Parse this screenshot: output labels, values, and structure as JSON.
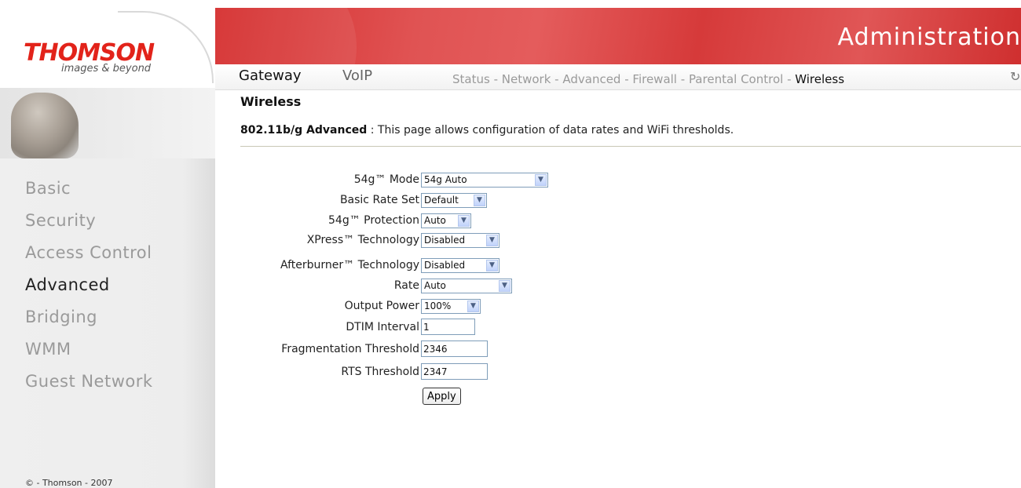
{
  "logo": {
    "brand": "THOMSON",
    "tagline": "images & beyond"
  },
  "header": {
    "title": "Administration"
  },
  "topnav": {
    "tabs": [
      "Gateway",
      "VoIP"
    ],
    "sub_items": [
      "Status",
      "Network",
      "Advanced",
      "Firewall",
      "Parental Control",
      "Wireless"
    ],
    "separator": " - ",
    "current": "Wireless"
  },
  "sidebar": {
    "items": [
      "Basic",
      "Security",
      "Access Control",
      "Advanced",
      "Bridging",
      "WMM",
      "Guest Network"
    ],
    "active": "Advanced",
    "copyright": "© - Thomson - 2007"
  },
  "page": {
    "title": "Wireless",
    "desc_bold": "802.11b/g Advanced",
    "desc_text": " :  This page allows configuration of data rates and WiFi thresholds."
  },
  "form": {
    "mode_label": "54g™ Mode",
    "mode_value": "54g Auto",
    "basic_rate_label": "Basic Rate Set",
    "basic_rate_value": "Default",
    "protection_label": "54g™ Protection",
    "protection_value": "Auto",
    "xpress_label": "XPress™ Technology",
    "xpress_value": "Disabled",
    "afterburner_label": "Afterburner™ Technology",
    "afterburner_value": "Disabled",
    "rate_label": "Rate",
    "rate_value": "Auto",
    "output_power_label": "Output Power",
    "output_power_value": "100%",
    "dtim_label": "DTIM Interval",
    "dtim_value": "1",
    "frag_label": "Fragmentation Threshold",
    "frag_value": "2346",
    "rts_label": "RTS Threshold",
    "rts_value": "2347",
    "apply_label": "Apply"
  },
  "colors": {
    "banner_red": "#d42b2b",
    "nav_inactive": "#9a9a9a",
    "input_border": "#7f9db9"
  }
}
